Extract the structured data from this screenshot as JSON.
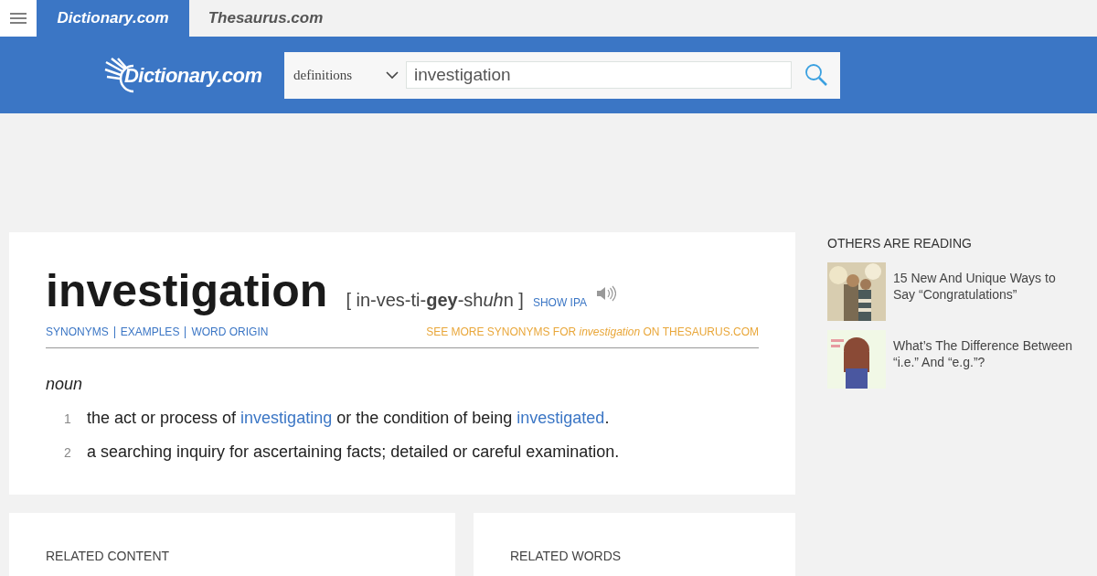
{
  "site_tabs": [
    {
      "label": "Dictionary.com",
      "selected": true
    },
    {
      "label": "Thesaurus.com",
      "selected": false
    }
  ],
  "header": {
    "logo": "Dictionary.com",
    "search_type": "definitions",
    "search_value": "investigation"
  },
  "entry": {
    "word": "investigation",
    "pronunciation": [
      {
        "kind": "plain",
        "text": "[ in-ves-ti-"
      },
      {
        "kind": "bold",
        "text": "gey"
      },
      {
        "kind": "plain",
        "text": "-sh"
      },
      {
        "kind": "italic",
        "text": "uh"
      },
      {
        "kind": "plain",
        "text": "n ]"
      }
    ],
    "show_ipa": "SHOW IPA",
    "links": [
      "SYNONYMS",
      "EXAMPLES",
      "WORD ORIGIN"
    ],
    "see_more": "SEE MORE SYNONYMS FOR *investigation* ON THESAURUS.COM",
    "part_of_speech": "noun",
    "definitions": [
      {
        "number": "1",
        "segments": [
          {
            "kind": "text",
            "text": "the act or process of "
          },
          {
            "kind": "link",
            "text": "investigating"
          },
          {
            "kind": "text",
            "text": " or the condition of being "
          },
          {
            "kind": "link",
            "text": "investigated"
          },
          {
            "kind": "text",
            "text": "."
          }
        ]
      },
      {
        "number": "2",
        "segments": [
          {
            "kind": "text",
            "text": "a searching inquiry for ascertaining facts; detailed or careful examination."
          }
        ]
      }
    ]
  },
  "others_reading": {
    "title": "OTHERS ARE READING",
    "items": [
      {
        "kind": "picture",
        "title": "15 New And Unique Ways to Say “Congratulations”"
      },
      {
        "kind": "picture",
        "title": "What’s The Difference Between “i.e.” And “e.g.”?"
      }
    ]
  },
  "related": [
    {
      "title": "RELATED CONTENT"
    },
    {
      "title": "RELATED WORDS"
    }
  ]
}
